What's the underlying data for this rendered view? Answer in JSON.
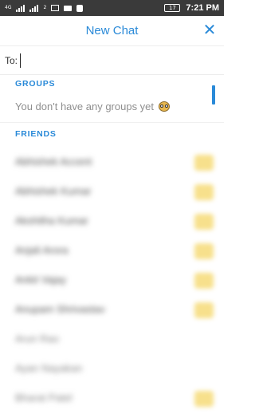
{
  "status_bar": {
    "carrier_badge": "4G",
    "sim_label": "2",
    "battery": "17",
    "time": "7:21 PM"
  },
  "header": {
    "title": "New Chat",
    "close_symbol": "✕"
  },
  "to_field": {
    "label": "To:",
    "value": "",
    "placeholder": ""
  },
  "groups": {
    "header": "GROUPS",
    "empty_message": "You don't have any groups yet"
  },
  "friends": {
    "header": "FRIENDS",
    "items": [
      {
        "name": "Abhishek Accent",
        "checkbox": "unchecked"
      },
      {
        "name": "Abhishek Kumar",
        "checkbox": "unchecked"
      },
      {
        "name": "Akshitha Kumar",
        "checkbox": "unchecked"
      },
      {
        "name": "Anjali Arora",
        "checkbox": "unchecked"
      },
      {
        "name": "Ankit Vajay",
        "checkbox": "unchecked"
      },
      {
        "name": "Anupam Shrivastav",
        "checkbox": "unchecked"
      },
      {
        "name": "Arun Rao",
        "checkbox": "unchecked"
      },
      {
        "name": "Ayan Nayakan",
        "checkbox": "unchecked"
      },
      {
        "name": "Bharat Patel",
        "checkbox": "unchecked"
      }
    ]
  },
  "colors": {
    "accent": "#2a8ad8",
    "status_bar_bg": "#3a3a3a",
    "muted_text": "#8f8f8f",
    "checkbox_fill": "#f7e08c"
  },
  "icons": {
    "close": "close-icon",
    "empty_groups_emoji": "worried-face-icon"
  }
}
